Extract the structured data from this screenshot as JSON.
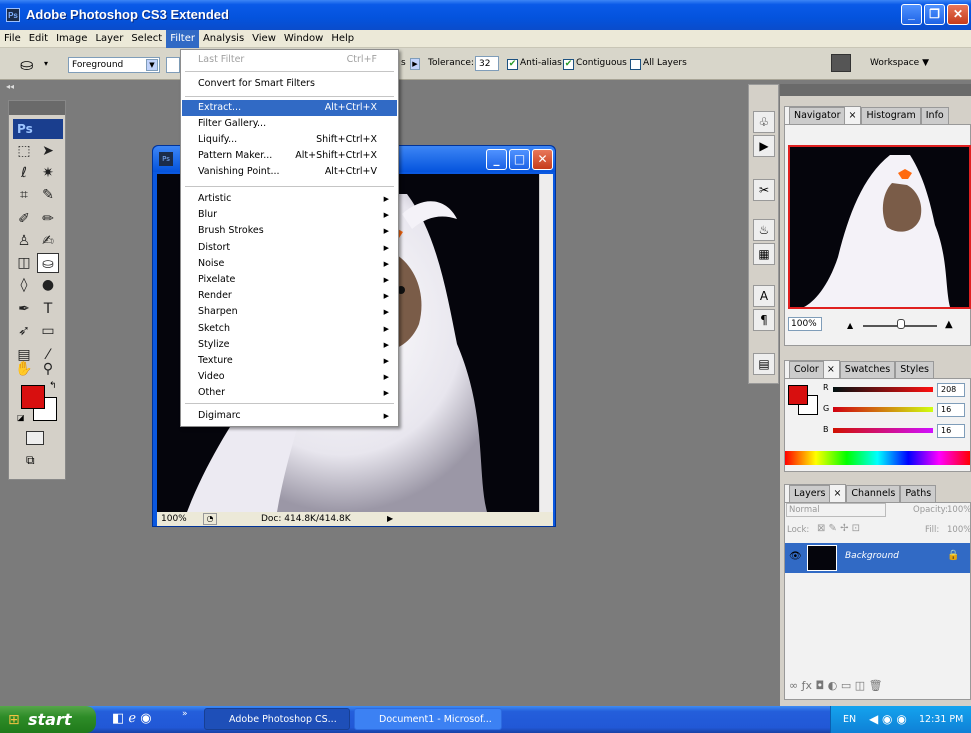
{
  "app": {
    "title": "Adobe Photoshop CS3 Extended",
    "icon": "Ps"
  },
  "menubar": [
    "File",
    "Edit",
    "Image",
    "Layer",
    "Select",
    "Filter",
    "Analysis",
    "View",
    "Window",
    "Help"
  ],
  "menubar_active": "Filter",
  "options": {
    "fill_source": "Foreground",
    "mode_fragment": "s",
    "tolerance_label": "Tolerance:",
    "tolerance_value": "32",
    "antialias_label": "Anti-alias",
    "antialias_checked": true,
    "contiguous_label": "Contiguous",
    "contiguous_checked": true,
    "alllayers_label": "All Layers",
    "alllayers_checked": false,
    "workspace_label": "Workspace"
  },
  "toolbox": {
    "logo": "Ps",
    "fg_color": "#d80f0f",
    "bg_color": "#ffffff"
  },
  "filter_menu": {
    "last_filter": {
      "label": "Last Filter",
      "shortcut": "Ctrl+F"
    },
    "convert": "Convert for Smart Filters",
    "group2": [
      {
        "label": "Extract...",
        "shortcut": "Alt+Ctrl+X"
      },
      {
        "label": "Filter Gallery...",
        "shortcut": ""
      },
      {
        "label": "Liquify...",
        "shortcut": "Shift+Ctrl+X"
      },
      {
        "label": "Pattern Maker...",
        "shortcut": "Alt+Shift+Ctrl+X"
      },
      {
        "label": "Vanishing Point...",
        "shortcut": "Alt+Ctrl+V"
      }
    ],
    "submenus": [
      "Artistic",
      "Blur",
      "Brush Strokes",
      "Distort",
      "Noise",
      "Pixelate",
      "Render",
      "Sharpen",
      "Sketch",
      "Stylize",
      "Texture",
      "Video",
      "Other"
    ],
    "digimarc": "Digimarc"
  },
  "document": {
    "zoom": "100%",
    "doc_size": "Doc: 414.8K/414.8K"
  },
  "navigator": {
    "tabs": [
      "Navigator",
      "Histogram",
      "Info"
    ],
    "zoom": "100%"
  },
  "color": {
    "tabs": [
      "Color",
      "Swatches",
      "Styles"
    ],
    "r": "208",
    "g": "16",
    "b": "16",
    "r_label": "R",
    "g_label": "G",
    "b_label": "B"
  },
  "layers": {
    "tabs": [
      "Layers",
      "Channels",
      "Paths"
    ],
    "blend": "Normal",
    "opacity_label": "Opacity:",
    "opacity": "100%",
    "lock_label": "Lock:",
    "fill_label": "Fill:",
    "fill": "100%",
    "layer_name": "Background"
  },
  "taskbar": {
    "start": "start",
    "tasks": [
      "Adobe Photoshop CS...",
      "Document1 - Microsof..."
    ],
    "lang": "EN",
    "clock": "12:31 PM"
  }
}
